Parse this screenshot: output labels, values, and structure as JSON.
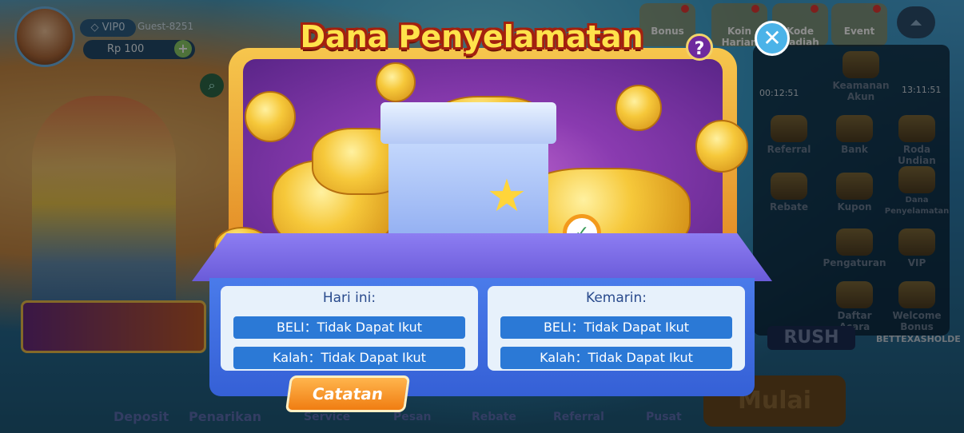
{
  "header": {
    "vip_label": "VIP0",
    "username": "Guest-8251",
    "balance": "Rp 100",
    "add_funds_symbol": "+"
  },
  "top_menu": {
    "items": [
      {
        "label": "Bonus"
      },
      {
        "label": "Koin Harian"
      },
      {
        "label": "Kode Hadiah"
      },
      {
        "label": "Event"
      }
    ]
  },
  "side_panel": {
    "timers": [
      "00:12:51",
      "13:11:51"
    ],
    "items": [
      {
        "label": "Keamanan Akun"
      },
      {
        "label": "Referral"
      },
      {
        "label": "Bank"
      },
      {
        "label": "Roda Undian"
      },
      {
        "label": "Rebate"
      },
      {
        "label": "Kupon"
      },
      {
        "label": "Dana Penyelamatan"
      },
      {
        "label": "Pengaturan"
      },
      {
        "label": "VIP"
      },
      {
        "label": "Daftar Acara"
      },
      {
        "label": "Welcome Bonus"
      }
    ],
    "banner": "RUSH",
    "brand": "BETTEXASHOLDE"
  },
  "bottom_nav": {
    "deposit": "Deposit",
    "withdraw": "Penarikan",
    "items": [
      "Service",
      "Pesan",
      "Rebate",
      "Referral",
      "Pusat"
    ],
    "start_label": "Mulai"
  },
  "modal": {
    "title": "Dana Penyelamatan",
    "help_symbol": "?",
    "close_symbol": "✕",
    "today": {
      "header": "Hari ini:",
      "buy_label": "BELI：",
      "buy_value": "Tidak Dapat Ikut",
      "loss_label": "Kalah：",
      "loss_value": "Tidak Dapat Ikut"
    },
    "yesterday": {
      "header": "Kemarin:",
      "buy_label": "BELI：",
      "buy_value": "Tidak Dapat Ikut",
      "loss_label": "Kalah：",
      "loss_value": "Tidak Dapat Ikut"
    },
    "notes_button": "Catatan"
  },
  "colors": {
    "title_fill": "#ffe24b",
    "title_stroke": "#a3210f",
    "panel_blue": "#3560d6",
    "row_blue": "#2b79d6",
    "button_orange": "#f07d12"
  }
}
